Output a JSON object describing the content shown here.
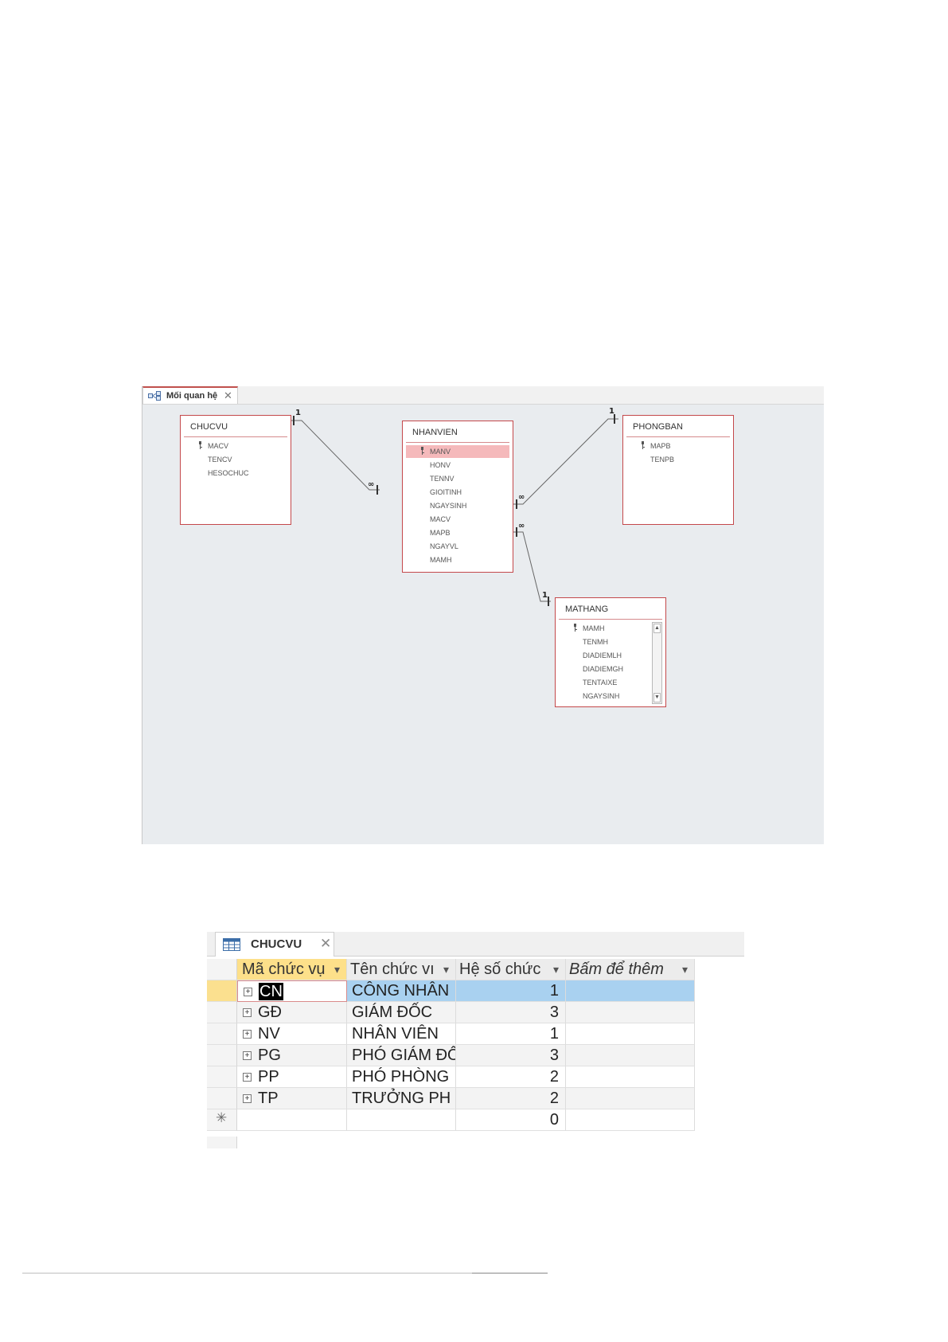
{
  "relationships_window": {
    "tab_label": "Mối quan hệ",
    "tables": {
      "chucvu": {
        "title": "CHUCVU",
        "fields": [
          "MACV",
          "TENCV",
          "HESOCHUC"
        ]
      },
      "nhanvien": {
        "title": "NHANVIEN",
        "fields": [
          "MANV",
          "HONV",
          "TENNV",
          "GIOITINH",
          "NGAYSINH",
          "MACV",
          "MAPB",
          "NGAYVL",
          "MAMH"
        ]
      },
      "phongban": {
        "title": "PHONGBAN",
        "fields": [
          "MAPB",
          "TENPB"
        ]
      },
      "mathang": {
        "title": "MATHANG",
        "fields": [
          "MAMH",
          "TENMH",
          "DIADIEMLH",
          "DIADIEMGH",
          "TENTAIXE",
          "NGAYSINH"
        ]
      }
    },
    "relation_labels": {
      "one": "1",
      "many": "∞"
    }
  },
  "datasheet": {
    "tab_label": "CHUCVU",
    "columns": [
      "Mã chức vụ",
      "Tên chức vı",
      "Hệ số chức",
      "Bấm để thêm"
    ],
    "rows": [
      {
        "ma": "CN",
        "ten": "CÔNG NHÂN",
        "heso": "1"
      },
      {
        "ma": "GĐ",
        "ten": "GIÁM ĐỐC",
        "heso": "3"
      },
      {
        "ma": "NV",
        "ten": "NHÂN VIÊN",
        "heso": "1"
      },
      {
        "ma": "PG",
        "ten": "PHÓ GIÁM ĐỐ",
        "heso": "3"
      },
      {
        "ma": "PP",
        "ten": "PHÓ PHÒNG",
        "heso": "2"
      },
      {
        "ma": "TP",
        "ten": "TRƯỞNG PH",
        "heso": "2"
      }
    ],
    "new_row": {
      "marker": "✳",
      "heso": "0"
    },
    "dropdown_glyph": "▾",
    "expander_glyph": "+"
  }
}
